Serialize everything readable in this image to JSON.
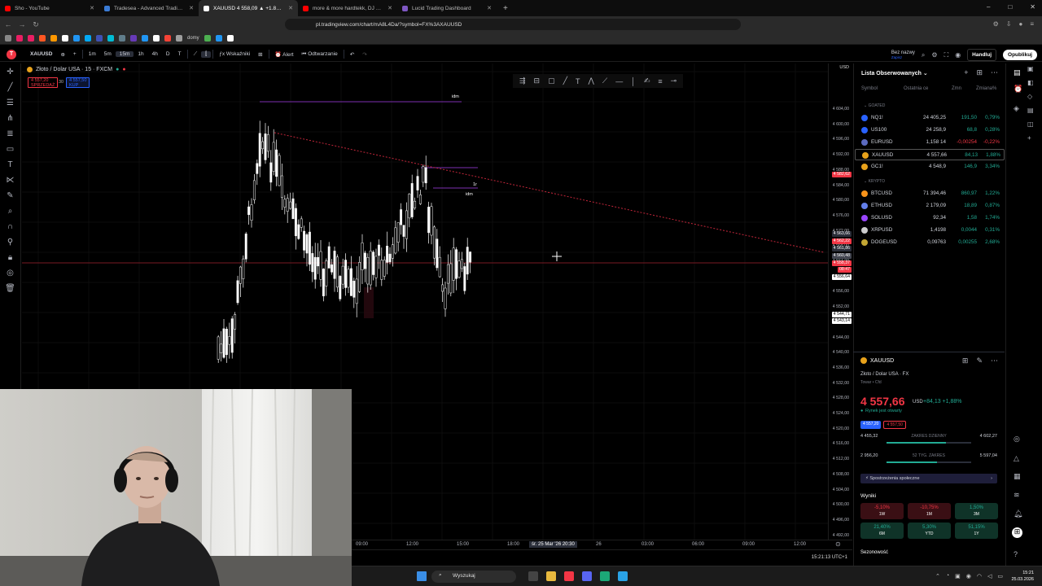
{
  "browser": {
    "tabs": [
      {
        "title": "Sho - YouTube",
        "color": "#ff0000",
        "active": false
      },
      {
        "title": "Tradesea - Advanced Trading Dashbo...",
        "color": "#3a7bd5",
        "active": false
      },
      {
        "title": "XAUUSD 4 558,09 ▲ +1.89% Be...",
        "color": "#ffffff",
        "active": true
      },
      {
        "title": "more & more hardtekk, DJ BEATCOIN",
        "color": "#ff0000",
        "active": false
      },
      {
        "title": "Lucid Trading Dashboard",
        "color": "#7e57c2",
        "active": false
      }
    ],
    "url": "pl.tradingview.com/chart/mA8L4Da/?symbol=FX%3AXAUUSD",
    "bookmark_folder": "domy",
    "window_controls": [
      "–",
      "□",
      "✕"
    ]
  },
  "tv_toolbar": {
    "symbol": "XAUUSD",
    "timeframes": [
      "1m",
      "5m",
      "15m",
      "1h",
      "4h",
      "D",
      "T"
    ],
    "active_timeframe": "15m",
    "indicators": "Wskaźniki",
    "alert": "Alert",
    "replay": "Odtwarzanie",
    "layout_name": "Bez nazwy",
    "layout_sub": "Zapisz",
    "trade_button": "Handluj",
    "publish_button": "Opublikuj"
  },
  "chart": {
    "legend_title": "Złoto / Dolar USA · 15 · FXCM",
    "sell_price": "4 557,20",
    "sell_label": "SPRZEDAŻ",
    "spread": "30",
    "buy_price": "4 557,50",
    "buy_label": "KUP",
    "label_idm_1": "idm",
    "label_1r": "1r",
    "label_idm_2": "idm",
    "currency": "USD",
    "price_ticks": [
      "4 604,00",
      "4 600,00",
      "4 596,00",
      "4 592,00",
      "4 588,00",
      "4 584,00",
      "4 580,00",
      "4 576,00",
      "4 572,00",
      "4 568,00",
      "4 564,00",
      "4 560,00",
      "4 556,00",
      "4 552,00",
      "4 548,00",
      "4 544,00",
      "4 540,00",
      "4 536,00",
      "4 532,00",
      "4 528,00",
      "4 524,00",
      "4 520,00",
      "4 516,00",
      "4 512,00",
      "4 508,00",
      "4 504,00",
      "4 500,00",
      "4 496,00",
      "4 492,00"
    ],
    "price_tags": [
      {
        "text": "4 582,62",
        "color": "#f23645"
      },
      {
        "text": "4 563,66",
        "color": "#2a2e39"
      },
      {
        "text": "4 562,22",
        "color": "#f23645"
      },
      {
        "text": "4 561,86",
        "color": "#2a2e39"
      },
      {
        "text": "4 560,48",
        "color": "#434651"
      },
      {
        "text": "4 558,37",
        "color": "#f23645"
      },
      {
        "text": "08:47",
        "color": "#f23645"
      },
      {
        "text": "4 556,64",
        "color": "#ffffff"
      },
      {
        "text": "4 544,71",
        "color": "#ffffff"
      },
      {
        "text": "4 543,14",
        "color": "#ffffff"
      }
    ],
    "time_ticks": [
      "09:00",
      "12:00",
      "15:00",
      "18:00",
      "26",
      "03:00",
      "06:00",
      "09:00",
      "12:00"
    ],
    "time_cursor": "śr. 25 Mar '26   20:30",
    "clock": "15:21:13 UTC+1"
  },
  "watchlist": {
    "title": "Lista Obserwowanych",
    "columns": [
      "Symbol",
      "Ostatnia ce",
      "Zmn",
      "Zmiana%"
    ],
    "groups": [
      "GOATED",
      "KRYPTO"
    ],
    "rows": [
      {
        "sym": "NQ1!",
        "last": "24 405,25",
        "chg": "191,50",
        "pct": "0,79%",
        "color": "#2962ff",
        "dir": "up"
      },
      {
        "sym": "US100",
        "last": "24 258,9",
        "chg": "68,8",
        "pct": "0,28%",
        "color": "#2962ff",
        "dir": "up"
      },
      {
        "sym": "EURUSD",
        "last": "1,158 14",
        "chg": "-0,00254",
        "pct": "-0,22%",
        "color": "#5c6bc0",
        "dir": "dn"
      },
      {
        "sym": "XAUUSD",
        "last": "4 557,66",
        "chg": "84,13",
        "pct": "1,88%",
        "color": "#e8a21b",
        "dir": "up"
      },
      {
        "sym": "GC1!",
        "last": "4 548,9",
        "chg": "146,9",
        "pct": "3,34%",
        "color": "#e8a21b",
        "dir": "up"
      },
      {
        "sym": "BTCUSD",
        "last": "71 394,46",
        "chg": "860,97",
        "pct": "1,22%",
        "color": "#f7931a",
        "dir": "up"
      },
      {
        "sym": "ETHUSD",
        "last": "2 179,09",
        "chg": "18,89",
        "pct": "0,87%",
        "color": "#627eea",
        "dir": "up"
      },
      {
        "sym": "SOLUSD",
        "last": "92,34",
        "chg": "1,58",
        "pct": "1,74%",
        "color": "#9945ff",
        "dir": "up"
      },
      {
        "sym": "XRPUSD",
        "last": "1,4198",
        "chg": "0,0044",
        "pct": "0,31%",
        "color": "#cccccc",
        "dir": "up"
      },
      {
        "sym": "DOGEUSD",
        "last": "0,09763",
        "chg": "0,00255",
        "pct": "2,68%",
        "color": "#c2a633",
        "dir": "up"
      }
    ]
  },
  "details": {
    "symbol": "XAUUSD",
    "name": "Złoto / Dolar USA  ·  FX",
    "sub": "Towar • Cfd",
    "price": "4 557,66",
    "currency": "USD",
    "change": "+84,13  +1,88%",
    "market_status": "Rynek jest otwarty",
    "tag_sell": "4 557,20",
    "tag_buy": "4 557,50",
    "day_low": "4 455,32",
    "day_label": "ZAKRES DZIENNY",
    "day_high": "4 602,27",
    "day_fill": 0.7,
    "wk_low": "2 956,20",
    "wk_label": "52 TYG. ZAKRES",
    "wk_high": "5 597,04",
    "wk_fill": 0.6,
    "community": "Spostrzeżenia społeczne",
    "results_title": "Wyniki",
    "perf": [
      {
        "val": "-5,10%",
        "per": "1W",
        "sign": "neg"
      },
      {
        "val": "-10,75%",
        "per": "1M",
        "sign": "neg"
      },
      {
        "val": "1,50%",
        "per": "3M",
        "sign": "pos"
      },
      {
        "val": "21,40%",
        "per": "6M",
        "sign": "pos"
      },
      {
        "val": "5,30%",
        "per": "YTD",
        "sign": "pos"
      },
      {
        "val": "51,15%",
        "per": "1Y",
        "sign": "pos"
      }
    ],
    "season": "Sezonowość"
  },
  "taskbar": {
    "search": "Wyszukaj",
    "time": "15:21",
    "date": "25.03.2026"
  }
}
